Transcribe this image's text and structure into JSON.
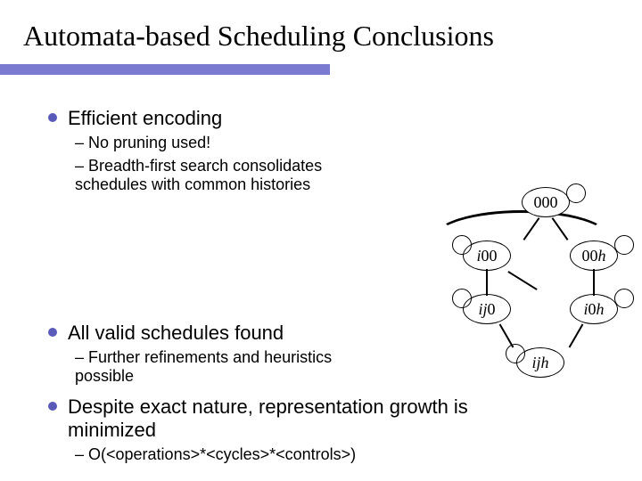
{
  "title": "Automata-based Scheduling Conclusions",
  "bullets": [
    {
      "text": "Efficient encoding",
      "subs": [
        "No pruning used!",
        "Breadth-first search consolidates schedules with common histories"
      ]
    },
    {
      "text": "All valid schedules found",
      "subs": [
        "Further refinements and heuristics possible"
      ]
    },
    {
      "text": "Despite exact nature, representation growth is minimized",
      "subs": [
        "O(<operations>*<cycles>*<controls>)"
      ]
    }
  ],
  "diagram": {
    "nodes": {
      "n000": "000",
      "ni00_i": "i",
      "ni00_rest": "00",
      "n00h_z": "00",
      "n00h_h": "h",
      "nij0_ij": "ij",
      "nij0_z": "0",
      "ni0h_i": "i",
      "ni0h_mid": "0",
      "ni0h_h": "h",
      "nijh_ij": "ij",
      "nijh_h": "h"
    }
  }
}
